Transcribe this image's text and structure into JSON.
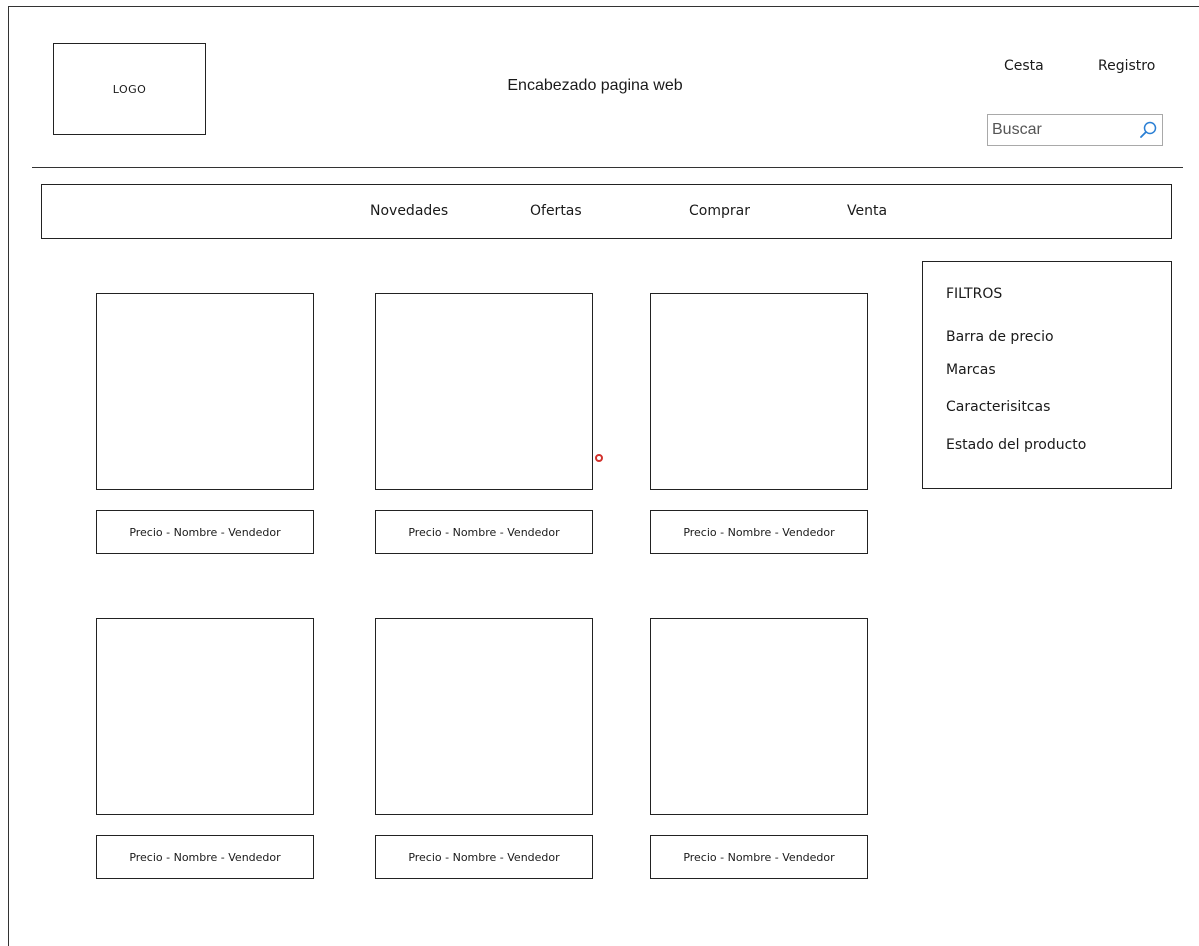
{
  "header": {
    "logo_text": "LOGO",
    "title": "Encabezado pagina web",
    "links": {
      "cart": "Cesta",
      "register": "Registro"
    },
    "search": {
      "placeholder": "Buscar"
    }
  },
  "nav": {
    "items": [
      "Novedades",
      "Ofertas",
      "Comprar",
      "Venta"
    ]
  },
  "filters": {
    "title": "FILTROS",
    "items": [
      "Barra de precio",
      "Marcas",
      "Caracterisitcas",
      "Estado del producto"
    ]
  },
  "products": [
    {
      "label": "Precio - Nombre - Vendedor"
    },
    {
      "label": "Precio - Nombre - Vendedor"
    },
    {
      "label": "Precio - Nombre - Vendedor"
    },
    {
      "label": "Precio - Nombre - Vendedor"
    },
    {
      "label": "Precio - Nombre - Vendedor"
    },
    {
      "label": "Precio - Nombre - Vendedor"
    }
  ],
  "colors": {
    "search_icon": "#2a7fd4",
    "cursor_marker": "#d2322d"
  }
}
